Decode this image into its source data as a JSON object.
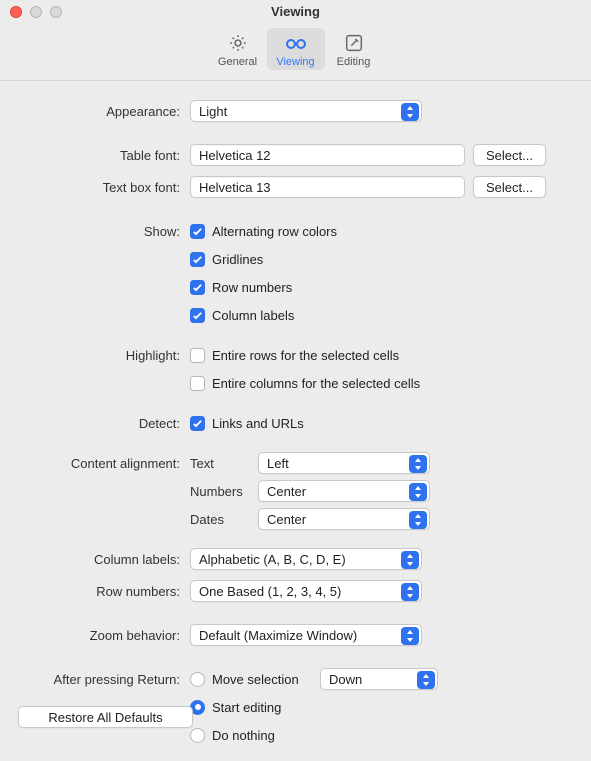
{
  "window": {
    "title": "Viewing"
  },
  "toolbar": {
    "general": "General",
    "viewing": "Viewing",
    "editing": "Editing"
  },
  "labels": {
    "appearance": "Appearance:",
    "table_font": "Table font:",
    "text_box_font": "Text box font:",
    "show": "Show:",
    "highlight": "Highlight:",
    "detect": "Detect:",
    "content_alignment": "Content alignment:",
    "column_labels": "Column labels:",
    "row_numbers": "Row numbers:",
    "zoom_behavior": "Zoom behavior:",
    "after_return": "After pressing Return:"
  },
  "appearance": {
    "value": "Light"
  },
  "fonts": {
    "table": "Helvetica 12",
    "textbox": "Helvetica 13",
    "select_button": "Select..."
  },
  "show": {
    "alternating": {
      "on": true,
      "label": "Alternating row colors"
    },
    "gridlines": {
      "on": true,
      "label": "Gridlines"
    },
    "rownumbers": {
      "on": true,
      "label": "Row numbers"
    },
    "collabels": {
      "on": true,
      "label": "Column labels"
    }
  },
  "highlight": {
    "rows": {
      "on": false,
      "label": "Entire rows for the selected cells"
    },
    "columns": {
      "on": false,
      "label": "Entire columns for the selected cells"
    }
  },
  "detect": {
    "links": {
      "on": true,
      "label": "Links and URLs"
    }
  },
  "alignment": {
    "text": {
      "label": "Text",
      "value": "Left"
    },
    "numbers": {
      "label": "Numbers",
      "value": "Center"
    },
    "dates": {
      "label": "Dates",
      "value": "Center"
    }
  },
  "column_labels": {
    "value": "Alphabetic (A, B, C, D, E)"
  },
  "row_numbers": {
    "value": "One Based (1, 2, 3, 4, 5)"
  },
  "zoom": {
    "value": "Default (Maximize Window)"
  },
  "return": {
    "move": {
      "label": "Move selection",
      "value": "Down"
    },
    "start": {
      "label": "Start editing"
    },
    "nothing": {
      "label": "Do nothing"
    }
  },
  "footer": {
    "restore": "Restore All Defaults"
  }
}
